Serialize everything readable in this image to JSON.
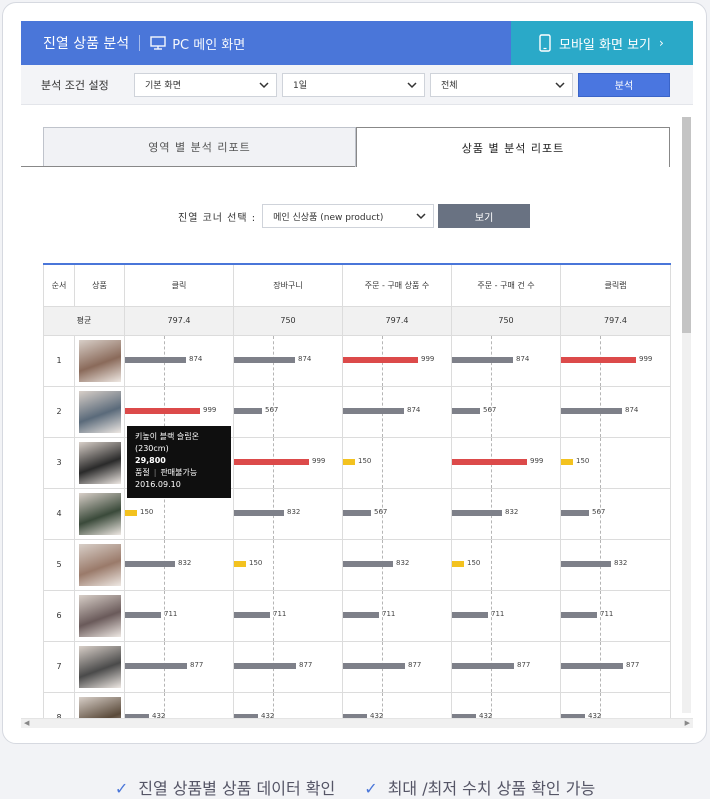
{
  "topbar": {
    "title": "진열 상품 분석",
    "pc_label": "PC 메인 화면",
    "mobile_label": "모바일 화면 보기",
    "mobile_chevron": "›"
  },
  "conditions": {
    "label": "분석 조건 설정",
    "select1": "기본 화면",
    "select2": "1일",
    "select3": "전체",
    "analyze_button": "분석"
  },
  "tabs": {
    "area": "영역 별 분석 리포트",
    "product": "상품 별 분석 리포트"
  },
  "corner": {
    "label": "진열 코너 선택 :",
    "selected": "메인 신상품 (new product)",
    "view_button": "보기"
  },
  "table": {
    "headers": [
      "순서",
      "상품",
      "클릭",
      "장바구니",
      "주문 - 구매 상품 수",
      "주문 - 구매 건 수",
      "클릭랩"
    ],
    "avg": [
      "평균",
      "797.4",
      "750",
      "797.4",
      "750",
      "797.4"
    ],
    "rows": [
      {
        "n": "1",
        "v": [
          "874",
          "874",
          "999",
          "874",
          "999"
        ],
        "c": [
          "gray",
          "gray",
          "red",
          "gray",
          "red"
        ],
        "w": [
          61,
          61,
          75,
          61,
          75
        ],
        "img": "#8a6a5a"
      },
      {
        "n": "2",
        "v": [
          "999",
          "567",
          "874",
          "567",
          "874"
        ],
        "c": [
          "red",
          "gray",
          "gray",
          "gray",
          "gray"
        ],
        "w": [
          75,
          28,
          61,
          28,
          61
        ],
        "img": "#5a6a7a"
      },
      {
        "n": "3",
        "v": [
          "",
          "999",
          "150",
          "999",
          "150"
        ],
        "c": [
          "gray",
          "red",
          "yellow",
          "red",
          "yellow"
        ],
        "w": [
          0,
          75,
          12,
          75,
          12
        ],
        "img": "#2a2a2a"
      },
      {
        "n": "4",
        "v": [
          "150",
          "832",
          "567",
          "832",
          "567"
        ],
        "c": [
          "yellow",
          "gray",
          "gray",
          "gray",
          "gray"
        ],
        "w": [
          12,
          50,
          28,
          50,
          28
        ],
        "img": "#3a4a3a"
      },
      {
        "n": "5",
        "v": [
          "832",
          "150",
          "832",
          "150",
          "832"
        ],
        "c": [
          "gray",
          "yellow",
          "gray",
          "yellow",
          "gray"
        ],
        "w": [
          50,
          12,
          50,
          12,
          50
        ],
        "img": "#9a7a6a"
      },
      {
        "n": "6",
        "v": [
          "711",
          "711",
          "711",
          "711",
          "711"
        ],
        "c": [
          "gray",
          "gray",
          "gray",
          "gray",
          "gray"
        ],
        "w": [
          36,
          36,
          36,
          36,
          36
        ],
        "img": "#6a5a5a"
      },
      {
        "n": "7",
        "v": [
          "877",
          "877",
          "877",
          "877",
          "877"
        ],
        "c": [
          "gray",
          "gray",
          "gray",
          "gray",
          "gray"
        ],
        "w": [
          62,
          62,
          62,
          62,
          62
        ],
        "img": "#4a4a4a"
      },
      {
        "n": "8",
        "v": [
          "432",
          "432",
          "432",
          "432",
          "432"
        ],
        "c": [
          "gray",
          "gray",
          "gray",
          "gray",
          "gray"
        ],
        "w": [
          24,
          24,
          24,
          24,
          24
        ],
        "img": "#5a4a3a"
      }
    ]
  },
  "tooltip": {
    "name": "키높이 블랙 슬립온",
    "size": "(230cm)",
    "price": "29,800",
    "status1": "품절",
    "status2": "판매불가능",
    "date": "2016.09.10"
  },
  "colors": {
    "red": "#dc4a4a",
    "gray": "#7e8089",
    "yellow": "#f3c21f",
    "blue": "#4a76d9",
    "teal": "#2aa9c8"
  },
  "footer": {
    "item1": "진열 상품별 상품 데이터 확인",
    "item2": "최대 /최저 수치 상품 확인 가능"
  }
}
